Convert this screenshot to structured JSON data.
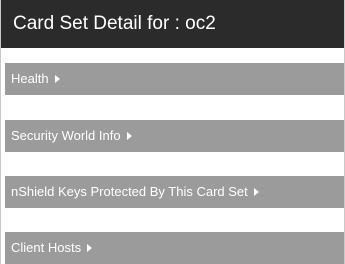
{
  "title": "Card Set Detail for : oc2",
  "sections": [
    {
      "label": "Health",
      "icon": "caret-right-icon"
    },
    {
      "label": "Security World Info",
      "icon": "caret-right-icon"
    },
    {
      "label": "nShield Keys Protected By This Card Set",
      "icon": "caret-right-icon"
    },
    {
      "label": "Client Hosts",
      "icon": "caret-right-icon"
    }
  ]
}
